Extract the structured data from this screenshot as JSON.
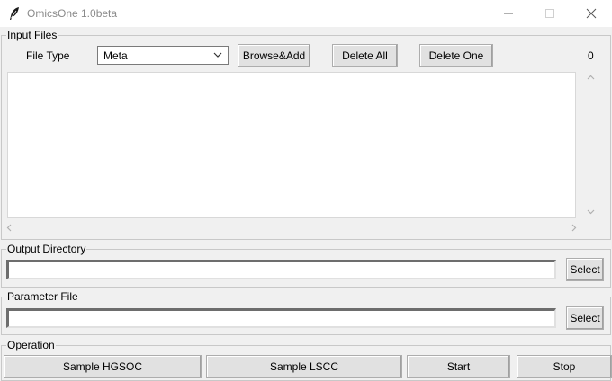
{
  "window": {
    "title": "OmicsOne 1.0beta",
    "icon": "feather-icon"
  },
  "input_files": {
    "label": "Input Files",
    "file_type_label": "File Type",
    "file_type_value": "Meta",
    "browse_add_label": "Browse&Add",
    "delete_all_label": "Delete All",
    "delete_one_label": "Delete One",
    "count": "0"
  },
  "output_directory": {
    "label": "Output Directory",
    "value": "",
    "select_label": "Select"
  },
  "parameter_file": {
    "label": "Parameter File",
    "value": "",
    "select_label": "Select"
  },
  "operation": {
    "label": "Operation",
    "sample_hgsoc_label": "Sample HGSOC",
    "sample_lscc_label": "Sample LSCC",
    "start_label": "Start",
    "stop_label": "Stop"
  },
  "colors": {
    "window_bg": "#f0f0f0",
    "title_text": "#8a8a8a"
  }
}
